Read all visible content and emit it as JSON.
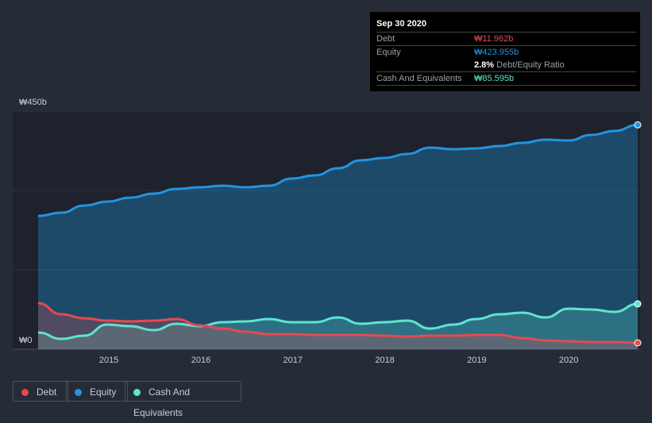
{
  "chart_data": {
    "type": "area",
    "title": "Debt to Equity History",
    "y_ticks": [
      "₩0",
      "₩450b"
    ],
    "ylim": [
      0,
      450
    ],
    "x_ticks": [
      "2015",
      "2016",
      "2017",
      "2018",
      "2019",
      "2020"
    ],
    "x_start": 2014.23,
    "x_end": 2020.75,
    "series": [
      {
        "name": "Debt",
        "color": "#e64a4f",
        "values": [
          87,
          66,
          58.5,
          54,
          52.5,
          54,
          57,
          45,
          39,
          33,
          28.5,
          28.5,
          27,
          27,
          27,
          25.5,
          24,
          25.5,
          25.5,
          27,
          27,
          21,
          16.5,
          15,
          13.5,
          13.5,
          12
        ]
      },
      {
        "name": "Equity",
        "color": "#2394df",
        "values": [
          252,
          258,
          271.5,
          279,
          286.5,
          294,
          303,
          306,
          309,
          306,
          309,
          322.5,
          328.5,
          342,
          357,
          361.5,
          369,
          381,
          378,
          379.5,
          384,
          390,
          396,
          394.5,
          405,
          412.5,
          424
        ]
      },
      {
        "name": "Cash And Equivalents",
        "color": "#5ee4cf",
        "values": [
          31.5,
          19.5,
          25.5,
          46.5,
          43.5,
          36,
          48,
          43.5,
          51,
          52.5,
          57,
          51,
          51,
          60,
          48,
          51,
          54,
          39,
          46.5,
          57,
          66,
          69,
          60,
          76.5,
          75,
          70.5,
          85.6
        ]
      }
    ]
  },
  "tooltip": {
    "date": "Sep 30 2020",
    "debt_label": "Debt",
    "debt_value": "₩11.962b",
    "equity_label": "Equity",
    "equity_value": "₩423.955b",
    "ratio_value": "2.8%",
    "ratio_label": "Debt/Equity Ratio",
    "cash_label": "Cash And Equivalents",
    "cash_value": "₩85.595b"
  },
  "legend": [
    "Debt",
    "Equity",
    "Cash And Equivalents"
  ]
}
